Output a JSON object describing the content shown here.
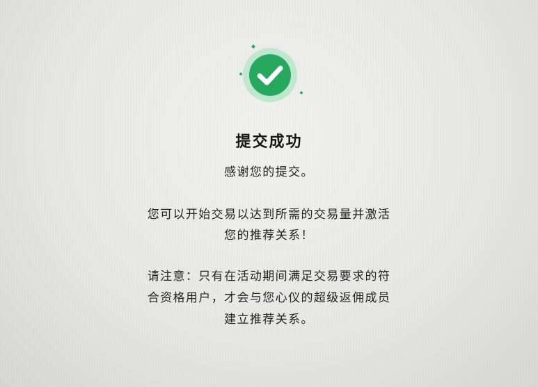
{
  "status": {
    "icon": "check-circle-icon",
    "color": "#27a85f"
  },
  "title": "提交成功",
  "thanks": "感谢您的提交。",
  "message_lines": [
    "您可以开始交易以达到所需的交易量并激活",
    "您的推荐关系！"
  ],
  "notice_lines": [
    "请注意：只有在活动期间满足交易要求的符",
    "合资格用户，才会与您心仪的超级返佣成员",
    "建立推荐关系。"
  ]
}
